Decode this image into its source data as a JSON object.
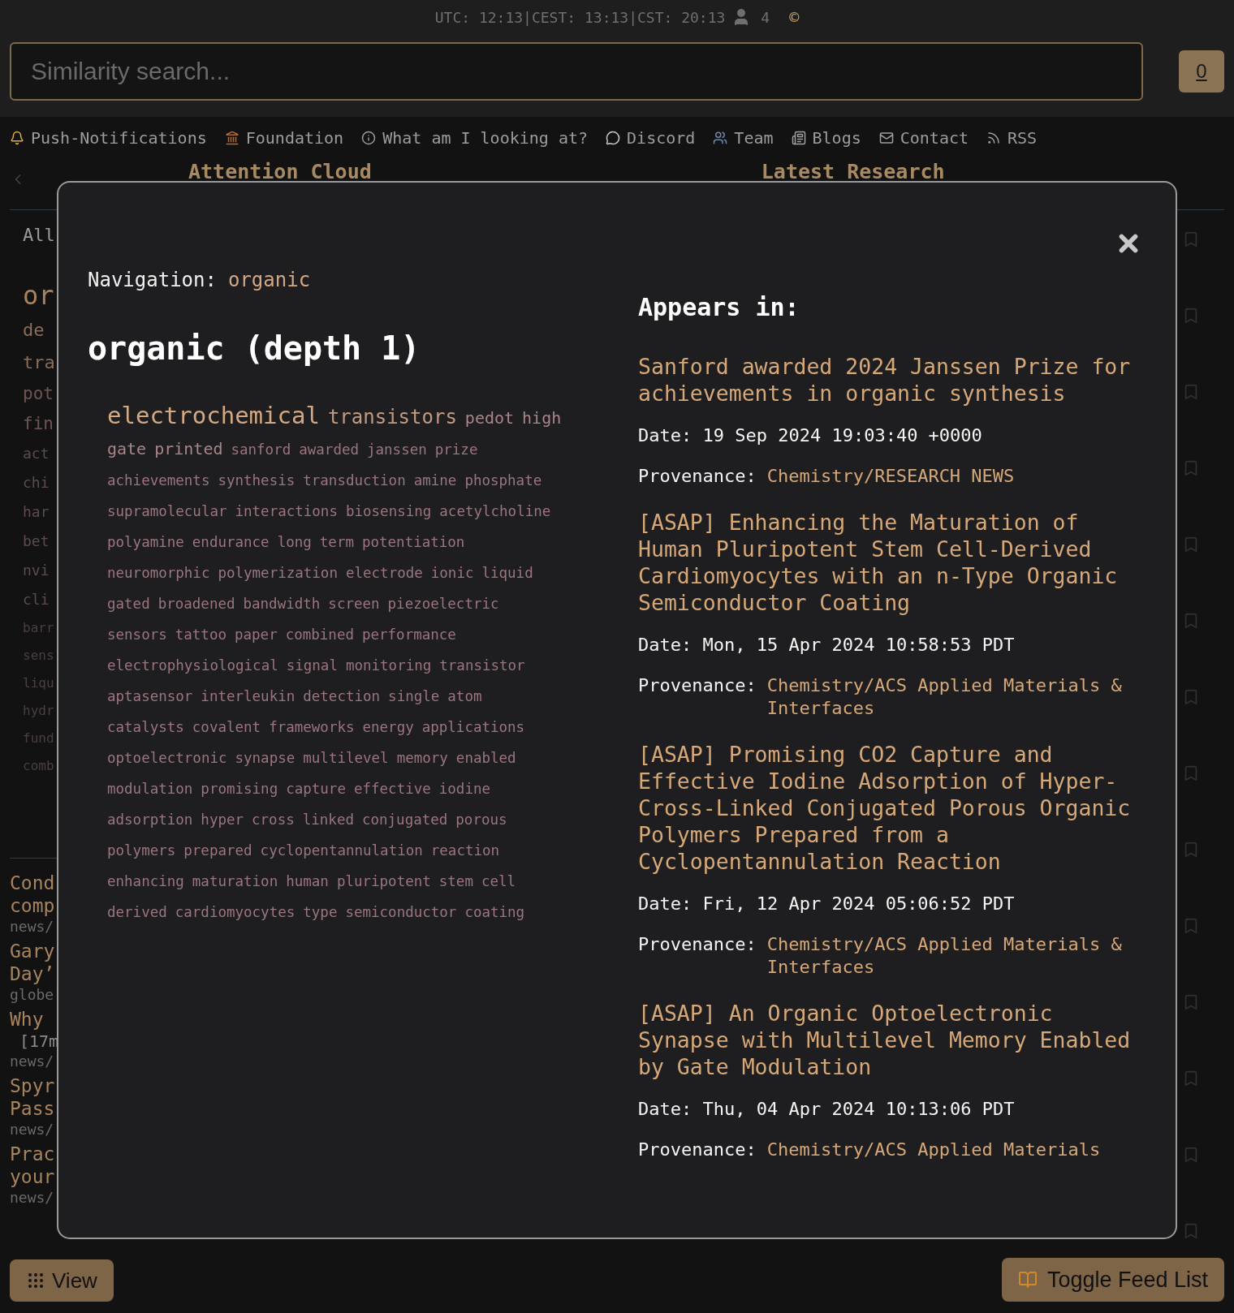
{
  "status_bar": {
    "times": "UTC: 12:13|CEST: 13:13|CST: 20:13",
    "users": "4",
    "copyright": "©"
  },
  "search": {
    "placeholder": "Similarity search...",
    "count": "0"
  },
  "nav": [
    {
      "label": "Push-Notifications"
    },
    {
      "label": "Foundation"
    },
    {
      "label": "What am I looking at?"
    },
    {
      "label": "Discord"
    },
    {
      "label": "Team"
    },
    {
      "label": "Blogs"
    },
    {
      "label": "Contact"
    },
    {
      "label": "RSS"
    }
  ],
  "columns": {
    "left": "Attention Cloud",
    "right": "Latest Research"
  },
  "background_cloud": {
    "filter": "All",
    "words": [
      {
        "text": "or",
        "kind": "xl"
      },
      {
        "text": "de",
        "kind": "lg"
      },
      {
        "text": "tra",
        "kind": "lg"
      },
      {
        "text": "pot",
        "kind": "md"
      },
      {
        "text": "fin",
        "kind": "md"
      },
      {
        "text": "act",
        "kind": "sm"
      },
      {
        "text": "chi",
        "kind": "sm"
      },
      {
        "text": "har",
        "kind": "sm"
      },
      {
        "text": "bet",
        "kind": "sm"
      },
      {
        "text": "nvi",
        "kind": "sm"
      },
      {
        "text": "cli",
        "kind": "sm"
      },
      {
        "text": "barr",
        "kind": "xs"
      },
      {
        "text": "sens",
        "kind": "xs"
      },
      {
        "text": "liqu",
        "kind": "xs"
      },
      {
        "text": "hydr",
        "kind": "xs"
      },
      {
        "text": "fund",
        "kind": "xs"
      },
      {
        "text": "comb",
        "kind": "xs"
      }
    ]
  },
  "background_feed": [
    {
      "title_lines": [
        "Cond",
        "comp"
      ],
      "source": "news/"
    },
    {
      "title_lines": [
        "Gary",
        "Day’"
      ],
      "source": "globe"
    },
    {
      "title_lines": [
        "Why"
      ],
      "meta": "[17m",
      "source": "news/"
    },
    {
      "title_lines": [
        "Spyr",
        "Pass"
      ],
      "source": "news/"
    },
    {
      "title_lines": [
        "Prac",
        "your"
      ],
      "source": "news/"
    }
  ],
  "modal": {
    "navigation_label": "Navigation:",
    "navigation_value": "organic",
    "heading": "organic (depth 1)",
    "cloud": [
      {
        "text": "electrochemical",
        "kind": "xl"
      },
      {
        "text": "transistors",
        "kind": "lg"
      },
      {
        "text": "pedot",
        "kind": "md"
      },
      {
        "text": "high",
        "kind": "md"
      },
      {
        "text": "gate",
        "kind": "md"
      },
      {
        "text": "printed",
        "kind": "md"
      },
      {
        "text": "sanford",
        "kind": "sm"
      },
      {
        "text": "awarded",
        "kind": "sm"
      },
      {
        "text": "janssen",
        "kind": "sm"
      },
      {
        "text": "prize",
        "kind": "sm"
      },
      {
        "text": "achievements",
        "kind": "sm"
      },
      {
        "text": "synthesis",
        "kind": "sm"
      },
      {
        "text": "transduction",
        "kind": "sm"
      },
      {
        "text": "amine",
        "kind": "sm"
      },
      {
        "text": "phosphate",
        "kind": "sm"
      },
      {
        "text": "supramolecular",
        "kind": "sm"
      },
      {
        "text": "interactions",
        "kind": "sm"
      },
      {
        "text": "biosensing",
        "kind": "sm"
      },
      {
        "text": "acetylcholine",
        "kind": "sm"
      },
      {
        "text": "polyamine",
        "kind": "sm"
      },
      {
        "text": "endurance",
        "kind": "sm"
      },
      {
        "text": "long",
        "kind": "sm"
      },
      {
        "text": "term",
        "kind": "sm"
      },
      {
        "text": "potentiation",
        "kind": "sm"
      },
      {
        "text": "neuromorphic",
        "kind": "sm"
      },
      {
        "text": "polymerization",
        "kind": "sm"
      },
      {
        "text": "electrode",
        "kind": "sm"
      },
      {
        "text": "ionic",
        "kind": "sm"
      },
      {
        "text": "liquid",
        "kind": "sm"
      },
      {
        "text": "gated",
        "kind": "sm"
      },
      {
        "text": "broadened",
        "kind": "sm"
      },
      {
        "text": "bandwidth",
        "kind": "sm"
      },
      {
        "text": "screen",
        "kind": "sm"
      },
      {
        "text": "piezoelectric",
        "kind": "sm"
      },
      {
        "text": "sensors",
        "kind": "sm"
      },
      {
        "text": "tattoo",
        "kind": "sm"
      },
      {
        "text": "paper",
        "kind": "sm"
      },
      {
        "text": "combined",
        "kind": "sm"
      },
      {
        "text": "performance",
        "kind": "sm"
      },
      {
        "text": "electrophysiological",
        "kind": "sm"
      },
      {
        "text": "signal",
        "kind": "sm"
      },
      {
        "text": "monitoring",
        "kind": "sm"
      },
      {
        "text": "transistor",
        "kind": "sm"
      },
      {
        "text": "aptasensor",
        "kind": "sm"
      },
      {
        "text": "interleukin",
        "kind": "sm"
      },
      {
        "text": "detection",
        "kind": "sm"
      },
      {
        "text": "single",
        "kind": "sm"
      },
      {
        "text": "atom",
        "kind": "sm"
      },
      {
        "text": "catalysts",
        "kind": "sm"
      },
      {
        "text": "covalent",
        "kind": "sm"
      },
      {
        "text": "frameworks",
        "kind": "sm"
      },
      {
        "text": "energy",
        "kind": "sm"
      },
      {
        "text": "applications",
        "kind": "sm"
      },
      {
        "text": "optoelectronic",
        "kind": "sm"
      },
      {
        "text": "synapse",
        "kind": "sm"
      },
      {
        "text": "multilevel",
        "kind": "sm"
      },
      {
        "text": "memory",
        "kind": "sm"
      },
      {
        "text": "enabled",
        "kind": "sm"
      },
      {
        "text": "modulation",
        "kind": "sm"
      },
      {
        "text": "promising",
        "kind": "sm"
      },
      {
        "text": "capture",
        "kind": "sm"
      },
      {
        "text": "effective",
        "kind": "sm"
      },
      {
        "text": "iodine",
        "kind": "sm"
      },
      {
        "text": "adsorption",
        "kind": "sm"
      },
      {
        "text": "hyper",
        "kind": "sm"
      },
      {
        "text": "cross",
        "kind": "sm"
      },
      {
        "text": "linked",
        "kind": "sm"
      },
      {
        "text": "conjugated",
        "kind": "sm"
      },
      {
        "text": "porous",
        "kind": "sm"
      },
      {
        "text": "polymers",
        "kind": "sm"
      },
      {
        "text": "prepared",
        "kind": "sm"
      },
      {
        "text": "cyclopentannulation",
        "kind": "sm"
      },
      {
        "text": "reaction",
        "kind": "sm"
      },
      {
        "text": "enhancing",
        "kind": "sm"
      },
      {
        "text": "maturation",
        "kind": "sm"
      },
      {
        "text": "human",
        "kind": "sm"
      },
      {
        "text": "pluripotent",
        "kind": "sm"
      },
      {
        "text": "stem",
        "kind": "sm"
      },
      {
        "text": "cell",
        "kind": "sm"
      },
      {
        "text": "derived",
        "kind": "sm"
      },
      {
        "text": "cardiomyocytes",
        "kind": "sm"
      },
      {
        "text": "type",
        "kind": "sm"
      },
      {
        "text": "semiconductor",
        "kind": "sm"
      },
      {
        "text": "coating",
        "kind": "sm"
      }
    ],
    "appears_heading": "Appears in:",
    "articles": [
      {
        "title": "Sanford awarded 2024 Janssen Prize for achievements in organic synthesis",
        "date": "Date: 19 Sep 2024 19:03:40 +0000",
        "provenance_label": "Provenance:",
        "provenance": "Chemistry/RESEARCH NEWS"
      },
      {
        "title": "[ASAP] Enhancing the Maturation of Human Pluripotent Stem Cell-Derived Cardiomyocytes with an n-Type Organic Semiconductor Coating",
        "date": "Date: Mon, 15 Apr 2024 10:58:53 PDT",
        "provenance_label": "Provenance:",
        "provenance": "Chemistry/ACS Applied Materials & Interfaces"
      },
      {
        "title": "[ASAP] Promising CO2 Capture and Effective Iodine Adsorption of Hyper-Cross-Linked Conjugated Porous Organic Polymers Prepared from a Cyclopentannulation Reaction",
        "date": "Date: Fri, 12 Apr 2024 05:06:52 PDT",
        "provenance_label": "Provenance:",
        "provenance": "Chemistry/ACS Applied Materials & Interfaces"
      },
      {
        "title": "[ASAP] An Organic Optoelectronic Synapse with Multilevel Memory Enabled by Gate Modulation",
        "date": "Date: Thu, 04 Apr 2024 10:13:06 PDT",
        "provenance_label": "Provenance:",
        "provenance": "Chemistry/ACS Applied Materials"
      }
    ]
  },
  "buttons": {
    "view": "View",
    "toggle": "Toggle Feed List"
  }
}
